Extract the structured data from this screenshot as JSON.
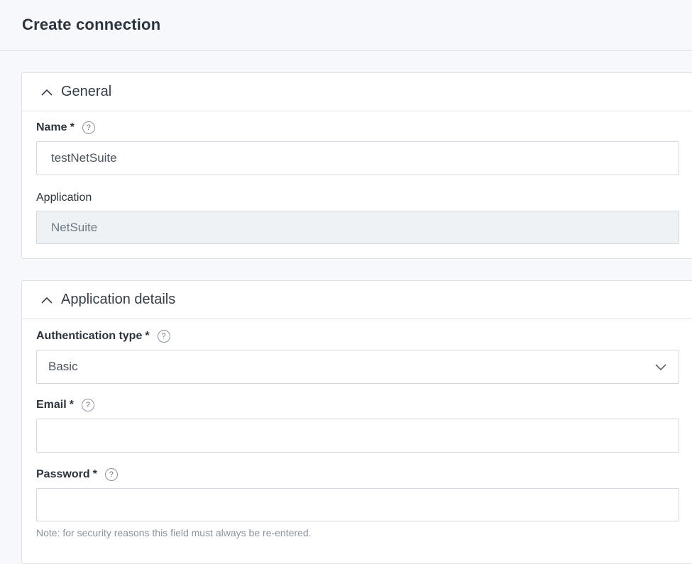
{
  "header": {
    "title": "Create connection"
  },
  "general": {
    "title": "General",
    "name": {
      "label": "Name",
      "required": "*",
      "help": "?",
      "value": "testNetSuite"
    },
    "application": {
      "label": "Application",
      "value": "NetSuite"
    }
  },
  "details": {
    "title": "Application details",
    "auth_type": {
      "label": "Authentication type",
      "required": "*",
      "help": "?",
      "value": "Basic"
    },
    "email": {
      "label": "Email",
      "required": "*",
      "help": "?",
      "value": ""
    },
    "password": {
      "label": "Password",
      "required": "*",
      "help": "?",
      "value": "",
      "note": "Note: for security reasons this field must always be re-entered."
    }
  },
  "icons": {
    "section_toggle": "chevron-up-icon",
    "select_toggle": "chevron-down-icon",
    "help": "help-icon"
  }
}
